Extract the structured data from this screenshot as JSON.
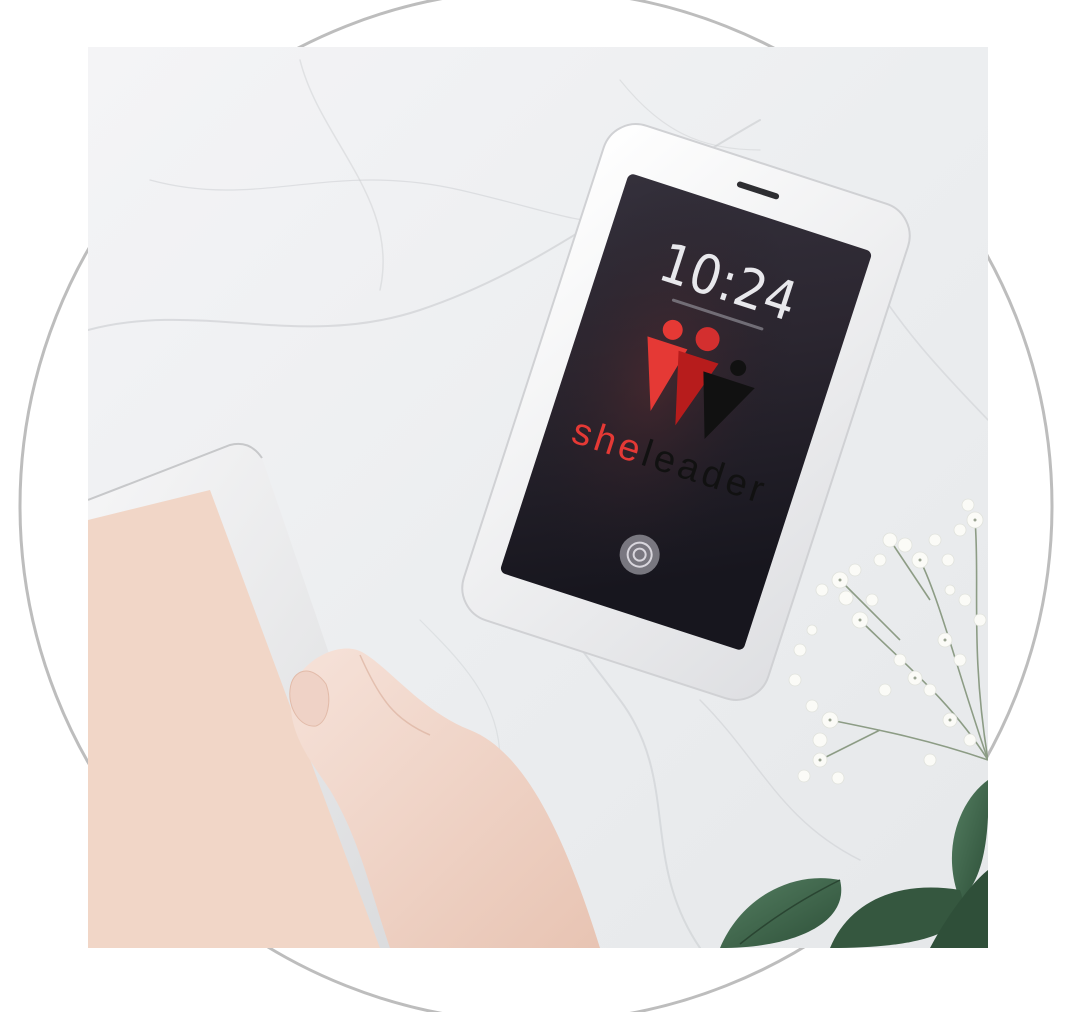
{
  "phone": {
    "time": "10:24",
    "brand": {
      "prefix": "she",
      "suffix": "leader"
    }
  },
  "colors": {
    "circle_outline": "#bdbdbd",
    "marble": "#eeeff1",
    "phone_body": "#f6f6f6",
    "screen_top": "#2f2b36",
    "screen_bottom": "#1b1a23",
    "brand_red": "#e53935",
    "brand_dark_red": "#b71c1c",
    "brand_black": "#111111",
    "tablet_pink": "#f1d6c7",
    "skin": "#f3d9cc",
    "leaf_green": "#3f6a4c",
    "flower_white": "#fbfbf7"
  },
  "icons": [
    "fingerprint-icon",
    "brand-logo-icon"
  ]
}
